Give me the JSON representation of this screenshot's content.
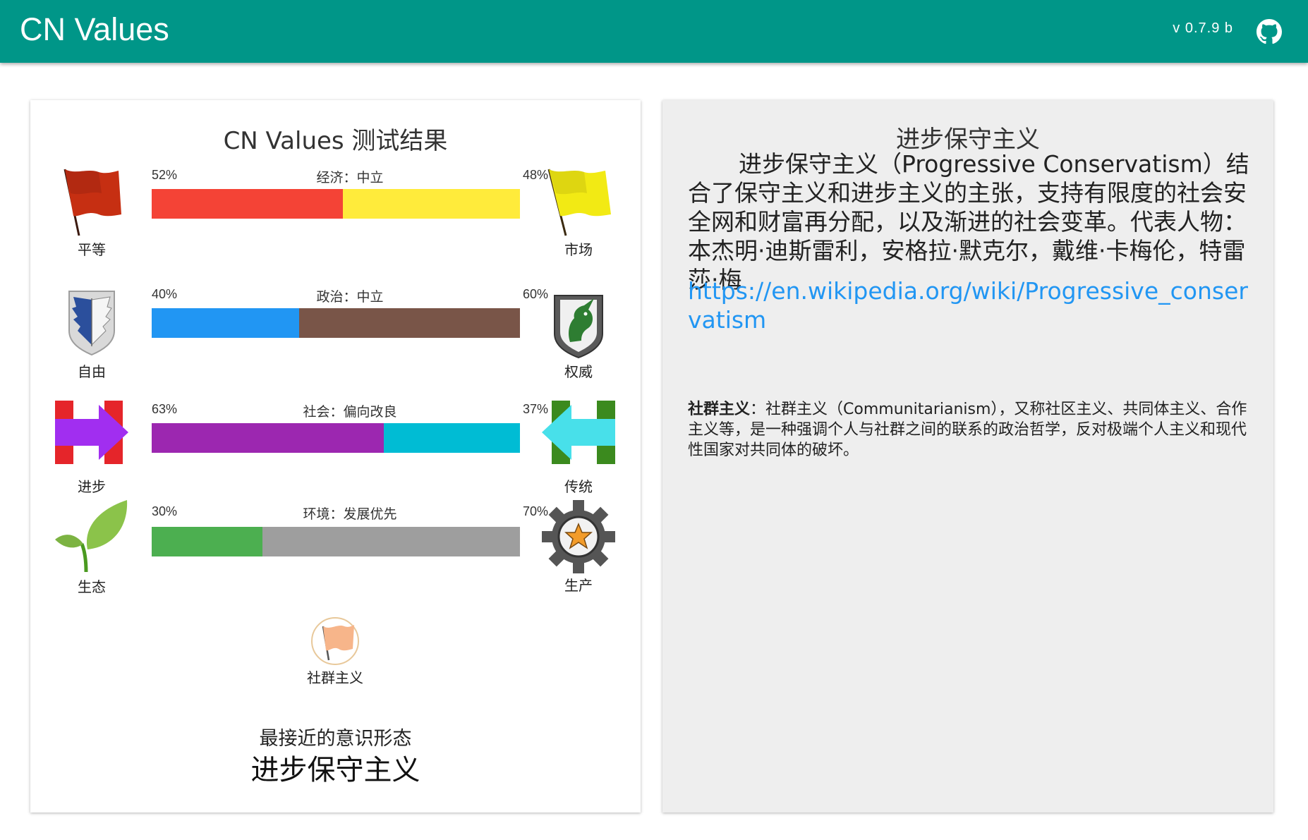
{
  "app": {
    "title": "CN Values",
    "version": "v 0.7.9 b",
    "github_icon": "github-icon"
  },
  "results": {
    "title": "CN Values 测试结果",
    "axes": [
      {
        "name": "经济：中立",
        "left_label": "平等",
        "right_label": "市场",
        "left_pct_text": "52%",
        "right_pct_text": "48%",
        "left_value": 52,
        "right_value": 48,
        "left_color": "#f44336",
        "right_color": "#ffeb3b",
        "left_icon": "red-flag-icon",
        "right_icon": "yellow-flag-icon"
      },
      {
        "name": "政治：中立",
        "left_label": "自由",
        "right_label": "权威",
        "left_pct_text": "40%",
        "right_pct_text": "60%",
        "left_value": 40,
        "right_value": 60,
        "left_color": "#2196f3",
        "right_color": "#795548",
        "left_icon": "wings-of-freedom-icon",
        "right_icon": "unicorn-shield-icon"
      },
      {
        "name": "社会：偏向改良",
        "left_label": "进步",
        "right_label": "传统",
        "left_pct_text": "63%",
        "right_pct_text": "37%",
        "left_value": 63,
        "right_value": 37,
        "left_color": "#9c27b0",
        "right_color": "#00bcd4",
        "left_icon": "arrow-right-icon",
        "right_icon": "arrow-left-icon"
      },
      {
        "name": "环境：发展优先",
        "left_label": "生态",
        "right_label": "生产",
        "left_pct_text": "30%",
        "right_pct_text": "70%",
        "left_value": 30,
        "right_value": 70,
        "left_color": "#4caf50",
        "right_color": "#9e9e9e",
        "left_icon": "sprout-icon",
        "right_icon": "gear-star-icon"
      }
    ],
    "matched_flag": {
      "label": "社群主义",
      "icon": "orange-flag-badge-icon"
    },
    "closest_label": "最接近的意识形态",
    "closest_ideology": "进步保守主义"
  },
  "ideology": {
    "title": "进步保守主义",
    "description": "进步保守主义（Progressive Conservatism）结合了保守主义和进步主义的主张，支持有限度的社会安全网和财富再分配，以及渐进的社会变革。代表人物：本杰明·迪斯雷利，安格拉·默克尔，戴维·卡梅伦，特雷莎·梅",
    "link": "https://en.wikipedia.org/wiki/Progressive_conservatism",
    "note_term": "社群主义",
    "note_colon": "：",
    "note_text": "社群主义（Communitarianism），又称社区主义、共同体主义、合作主义等，是一种强调个人与社群之间的联系的政治哲学，反对极端个人主义和现代性国家对共同体的破坏。"
  }
}
